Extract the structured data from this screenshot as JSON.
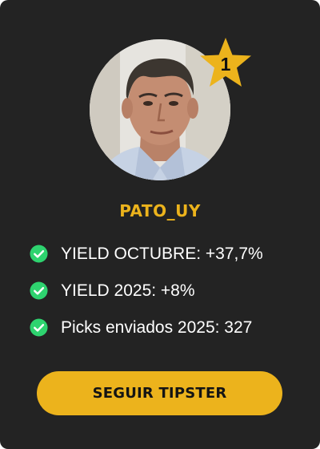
{
  "theme": {
    "card_background": "#232323",
    "accent": "#ecb31c",
    "text": "#ffffff",
    "check": "#2ed36f",
    "button_text": "#141414"
  },
  "tipster": {
    "rank": "1",
    "username": "PATO_UY",
    "avatar_icon": "profile-photo"
  },
  "stats": [
    {
      "icon": "check-circle-icon",
      "text": "YIELD OCTUBRE: +37,7%"
    },
    {
      "icon": "check-circle-icon",
      "text": "YIELD 2025: +8%"
    },
    {
      "icon": "check-circle-icon",
      "text": "Picks enviados 2025: 327"
    }
  ],
  "actions": {
    "follow_label": "SEGUIR TIPSTER"
  }
}
